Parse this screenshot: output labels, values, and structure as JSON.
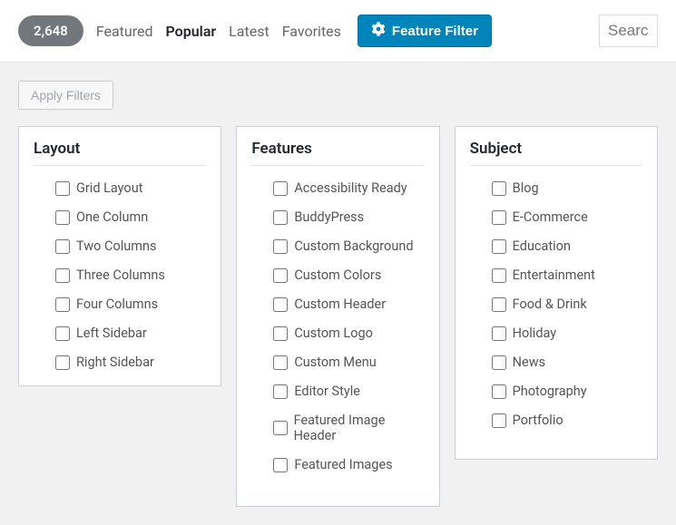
{
  "header": {
    "count": "2,648",
    "tabs": {
      "featured": "Featured",
      "popular": "Popular",
      "latest": "Latest",
      "favorites": "Favorites"
    },
    "feature_filter_label": "Feature Filter",
    "search_placeholder": "Search"
  },
  "apply_filters_label": "Apply Filters",
  "panels": {
    "layout": {
      "title": "Layout",
      "items": {
        "i0": "Grid Layout",
        "i1": "One Column",
        "i2": "Two Columns",
        "i3": "Three Columns",
        "i4": "Four Columns",
        "i5": "Left Sidebar",
        "i6": "Right Sidebar"
      }
    },
    "features": {
      "title": "Features",
      "items": {
        "i0": "Accessibility Ready",
        "i1": "BuddyPress",
        "i2": "Custom Background",
        "i3": "Custom Colors",
        "i4": "Custom Header",
        "i5": "Custom Logo",
        "i6": "Custom Menu",
        "i7": "Editor Style",
        "i8": "Featured Image Header",
        "i9": "Featured Images"
      }
    },
    "subject": {
      "title": "Subject",
      "items": {
        "i0": "Blog",
        "i1": "E-Commerce",
        "i2": "Education",
        "i3": "Entertainment",
        "i4": "Food & Drink",
        "i5": "Holiday",
        "i6": "News",
        "i7": "Photography",
        "i8": "Portfolio"
      }
    }
  }
}
